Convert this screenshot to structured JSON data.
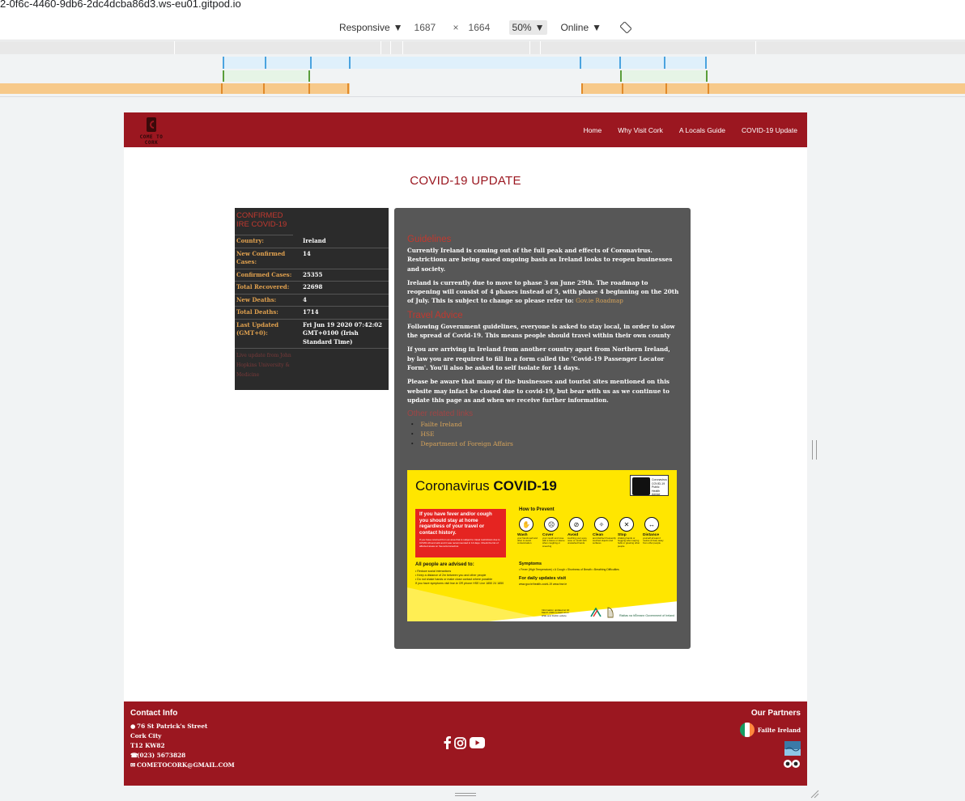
{
  "browser": {
    "url": "2-0f6c-4460-9db6-2dc4dcba86d3.ws-eu01.gitpod.io",
    "device_mode": "Responsive",
    "width": "1687",
    "height": "1664",
    "zoom": "50%",
    "throttle": "Online"
  },
  "site": {
    "logo_text": "COME TO CORK",
    "nav": [
      "Home",
      "Why Visit Cork",
      "A Locals Guide",
      "COVID-19 Update"
    ],
    "page_title": "COVID-19 UPDATE"
  },
  "stats": {
    "heading": "CONFIRMED IRE COVID-19",
    "rows": [
      {
        "label": "Country:",
        "value": "Ireland"
      },
      {
        "label": "New Confirmed Cases:",
        "value": "14"
      },
      {
        "label": "Confirmed Cases:",
        "value": "25355"
      },
      {
        "label": "Total Recovered:",
        "value": "22698"
      },
      {
        "label": "New Deaths:",
        "value": "4"
      },
      {
        "label": "Total Deaths:",
        "value": "1714"
      },
      {
        "label": "Last Updated (GMT+0):",
        "value": "Fri Jun 19 2020 07:42:02 GMT+0100 (Irish Standard Time)"
      }
    ],
    "source": "Live update from John Hopkins University & Medicine"
  },
  "info": {
    "guidelines_title": "Guidelines",
    "guidelines_p1": "Currently Ireland is coming out of the full peak and effects of Coronavirus. Restrictions are being eased ongoing basis as Ireland looks to reopen businesses and society.",
    "guidelines_p2": "Ireland is currently due to move to phase 3 on June 29th. The roadmap to reopening will consist of 4 phases instead of 5, with phase 4 beginning on the 20th of July. This is subject to change so please refer to:",
    "roadmap_link": "Gov.ie Roadmap",
    "travel_title": "Travel Advice",
    "travel_p1": "Following Government guidelines, everyone is asked to stay local, in order to slow the spread of Covid-19. This means people should travel within their own county",
    "travel_p2": "If you are arriving in Ireland from another country apart from Northern Ireland, by law you are required to fill in a form called the 'Covid-19 Passenger Locator Form'. You'll also be asked to self isolate for 14 days.",
    "travel_p3": "Please be aware that many of the businesses and tourist sites mentioned on this website may infact be closed due to covid-19, but bear with us as we continue to update this page as and when we receive further information.",
    "related_title": "Other related links",
    "links": [
      "Failte Ireland",
      "HSE",
      "Department of Foreign Affairs"
    ]
  },
  "poster": {
    "title_light": "Coronavirus",
    "title_bold": "COVID-19",
    "badge_text": "Coronavirus COVID-19 Public Health Advice",
    "red_text": "If you have fever and/or cough you should stay at home regardless of your travel or contact history.",
    "red_small": "If you have returned from an area that is subject to travel restrictions due to COVID-19 and sick and it was recommended in 14 days. Check the list of affected areas on hse.ie/coronavirus",
    "prevent_title": "How to Prevent",
    "prevent_items": [
      {
        "label": "Wash",
        "sub": "your hands well and often to avoid contamination",
        "icon": "wash-icon",
        "glyph": "✋"
      },
      {
        "label": "Cover",
        "sub": "your mouth and nose with a tissue or sleeve when coughing or sneezing",
        "icon": "cover-icon",
        "glyph": "☹"
      },
      {
        "label": "Avoid",
        "sub": "touching your eyes, nose or mouth with unwashed hands",
        "icon": "avoid-icon",
        "glyph": "⊘"
      },
      {
        "label": "Clean",
        "sub": "and disinfect frequently touched objects and surfaces",
        "icon": "clean-icon",
        "glyph": "✧"
      },
      {
        "label": "Stop",
        "sub": "shaking hands or hugging when saying hello or greeting other people",
        "icon": "stop-icon",
        "glyph": "✕"
      },
      {
        "label": "Distance",
        "sub": "yourself at least 2 metres (6 feet) away from other people",
        "icon": "distance-icon",
        "glyph": "↔"
      }
    ],
    "symptoms_title": "Symptoms",
    "symptoms_line": "• Fever (High Temperature)  • A Cough  • Shortness of Breath  • Breathing Difficulties",
    "updates_title": "For daily updates visit",
    "updates_line": "www.gov.ie/health-covid-19   www.hse.ie",
    "advised_title": "All people are advised to:",
    "advised_lines": [
      "• Reduce social interactions",
      "• Keep a distance of 2m between you and other people",
      "• Do not shake hands or make close contact where possible",
      "If you have symptoms visit hse.ie OR phone HSE Live 1850 24 1850"
    ],
    "footer_note": "Information updated at 10 March 2020 contact at on HSE and Dublin advice",
    "gov_text": "Rialtas na hÉireann Government of Ireland"
  },
  "footer": {
    "contact_title": "Contact Info",
    "address1": "76 St Patrick's Street",
    "address2": "Cork City",
    "address3": "T12 KW82",
    "phone": "(023) 5673828",
    "email": "COMETOCORK@GMAIL.COM",
    "partners_title": "Our Partners",
    "partner1": "Failte Ireland"
  },
  "colors": {
    "brand": "#9b1720",
    "card_dark": "#2b2b2b",
    "card_grey": "#575757",
    "link": "#d6a35a",
    "heading_red": "#c2392f",
    "poster_yellow": "#ffe600"
  }
}
